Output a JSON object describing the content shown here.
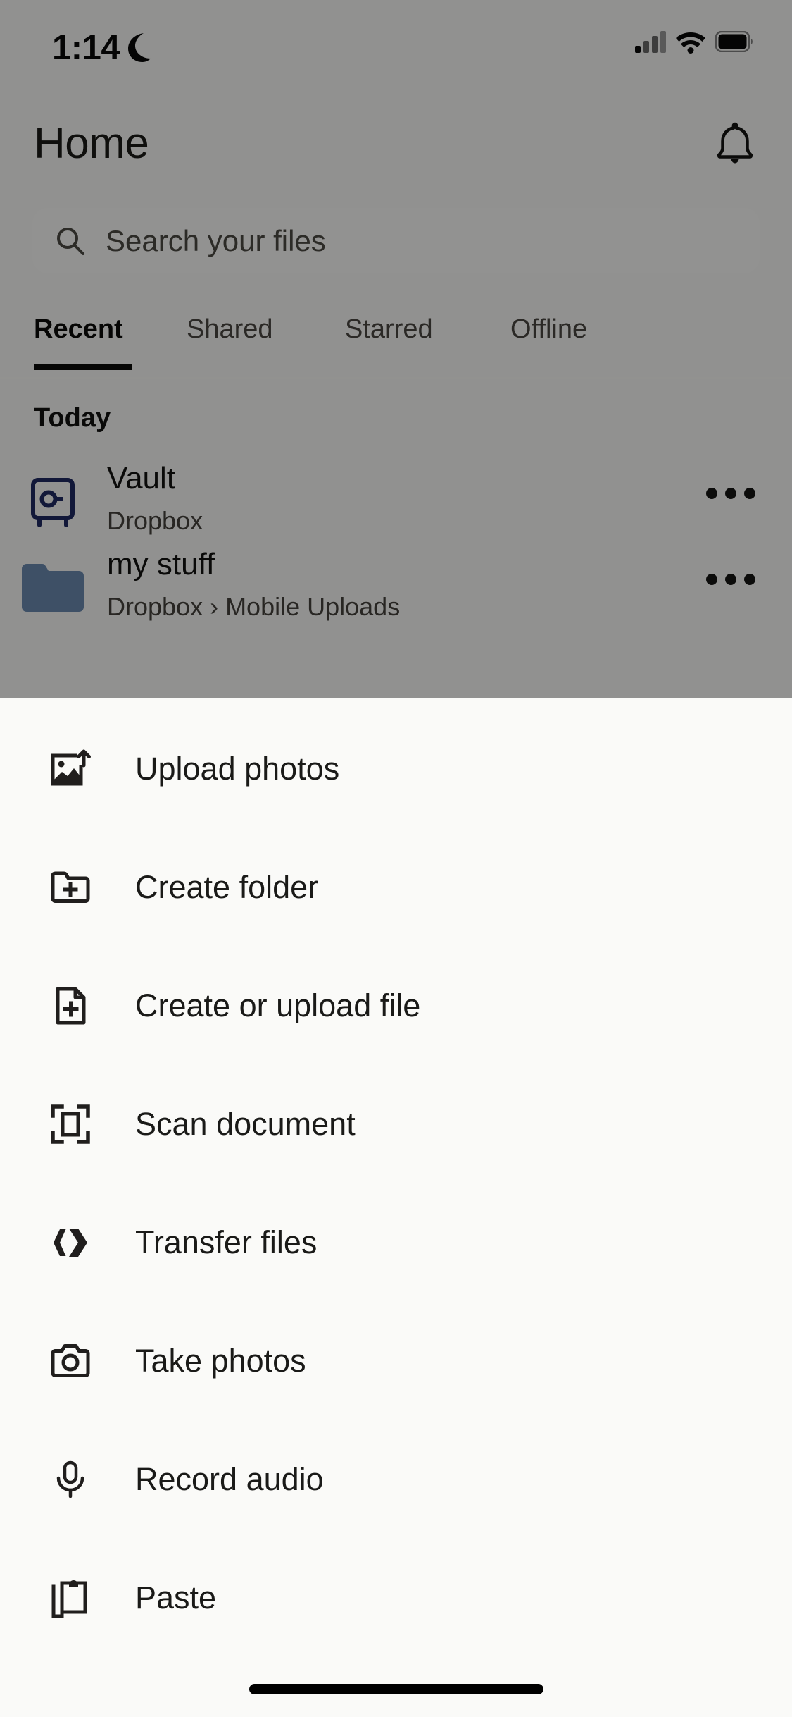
{
  "status_bar": {
    "time": "1:14",
    "dnd_icon": "crescent-moon-icon",
    "cellular_icon": "cellular-signal-icon",
    "wifi_icon": "wifi-icon",
    "battery_icon": "battery-full-icon"
  },
  "header": {
    "title": "Home",
    "notifications_icon": "bell-icon"
  },
  "search": {
    "placeholder": "Search your files",
    "value": "",
    "icon": "search-icon"
  },
  "tabs": [
    {
      "label": "Recent",
      "active": true
    },
    {
      "label": "Shared",
      "active": false
    },
    {
      "label": "Starred",
      "active": false
    },
    {
      "label": "Offline",
      "active": false
    }
  ],
  "file_list": {
    "section_label": "Today",
    "items": [
      {
        "name": "Vault",
        "location": "Dropbox",
        "icon": "vault-safe-icon",
        "icon_color": "#1f2a63",
        "overflow_icon": "more-horizontal-icon"
      },
      {
        "name": "my stuff",
        "location": "Dropbox › Mobile Uploads",
        "icon": "folder-icon",
        "icon_color": "#6b8bb0",
        "overflow_icon": "more-horizontal-icon"
      }
    ]
  },
  "bottom_sheet": {
    "items": [
      {
        "label": "Upload photos",
        "icon": "image-upload-icon"
      },
      {
        "label": "Create folder",
        "icon": "folder-plus-icon"
      },
      {
        "label": "Create or upload file",
        "icon": "file-plus-icon"
      },
      {
        "label": "Scan document",
        "icon": "document-scan-icon"
      },
      {
        "label": "Transfer files",
        "icon": "dropbox-transfer-icon"
      },
      {
        "label": "Take photos",
        "icon": "camera-icon"
      },
      {
        "label": "Record audio",
        "icon": "microphone-icon"
      },
      {
        "label": "Paste",
        "icon": "clipboard-icon"
      }
    ]
  },
  "colors": {
    "sheet_background": "#fafaf8",
    "text_primary": "#1a1a18",
    "accent_vault": "#1f2a63",
    "accent_folder": "#6b8bb0",
    "tab_active": "#0c0c0a"
  },
  "home_indicator": "home-indicator"
}
